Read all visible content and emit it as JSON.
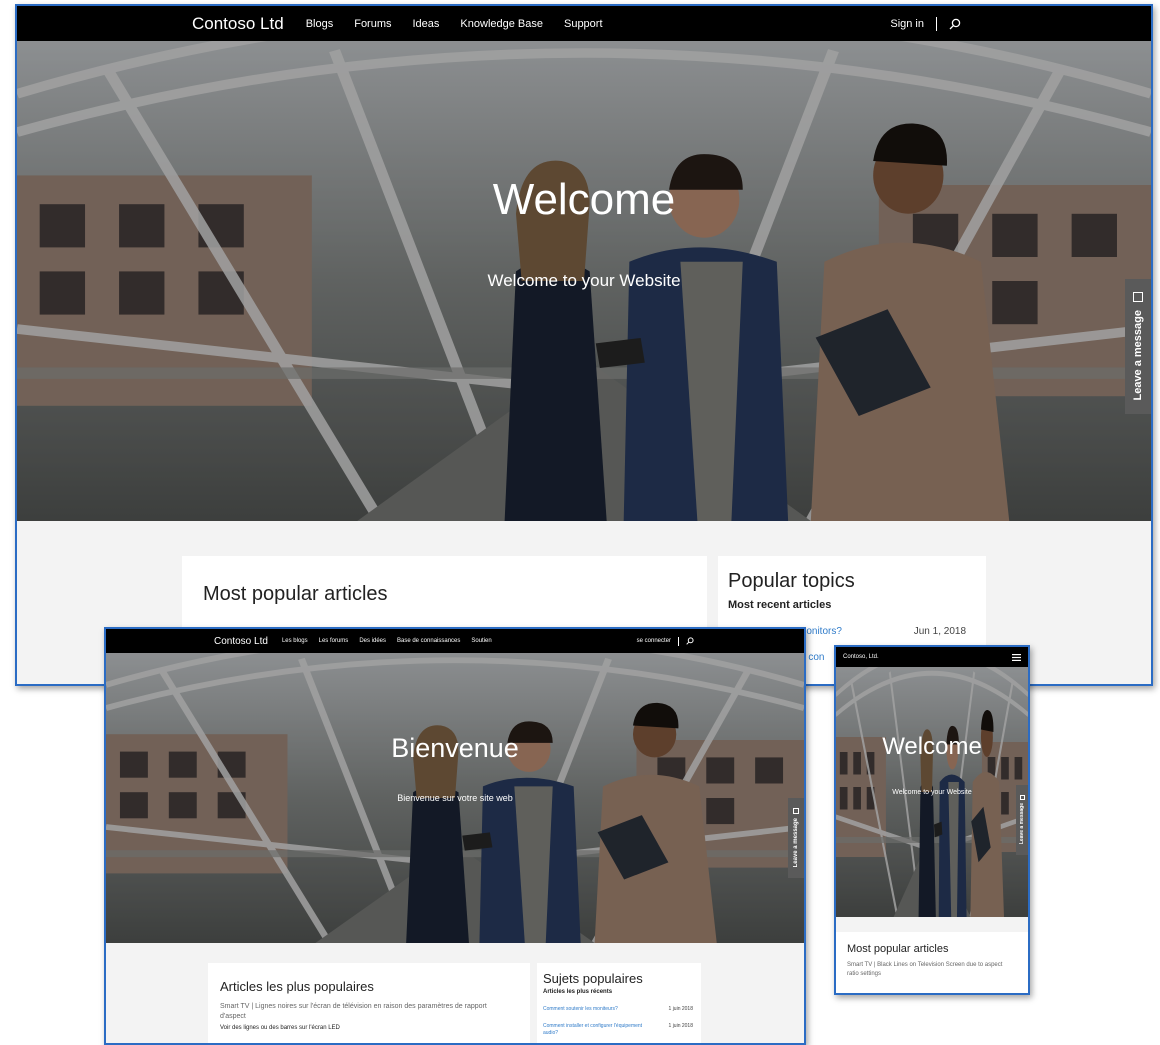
{
  "desktop_en": {
    "brand": "Contoso Ltd",
    "nav": [
      "Blogs",
      "Forums",
      "Ideas",
      "Knowledge Base",
      "Support"
    ],
    "sign_in": "Sign in",
    "hero_title": "Welcome",
    "hero_subtitle": "Welcome to your Website",
    "tab_label": "Leave a message",
    "articles_heading": "Most popular articles",
    "topics_heading": "Popular topics",
    "recent_heading": "Most recent articles",
    "recent_item_1": "Monitors?",
    "recent_item_1_date": "Jun 1, 2018",
    "recent_item_2": "d con"
  },
  "desktop_fr": {
    "brand": "Contoso Ltd",
    "nav": [
      "Les blogs",
      "Les forums",
      "Des idées",
      "Base de connaissances",
      "Soutien"
    ],
    "sign_in": "se connecter",
    "hero_title": "Bienvenue",
    "hero_subtitle": "Bienvenue sur votre site web",
    "tab_label": "Leave a message",
    "articles_heading": "Articles les plus populaires",
    "article_title": "Smart TV | Lignes noires sur l'écran de télévision en raison des paramètres de rapport d'aspect",
    "article_snippet": "Voir des lignes ou des barres sur l'écran LED",
    "topics_heading": "Sujets populaires",
    "recent_heading": "Articles les plus récents",
    "recent_item_1": "Comment soutenir les moniteurs?",
    "recent_item_1_date": "1 juin 2018",
    "recent_item_2": "Comment installer et configurer l'équipement audio?",
    "recent_item_2_date": "1 juin 2018"
  },
  "mobile_en": {
    "brand": "Contoso, Ltd.",
    "hero_title": "Welcome",
    "hero_subtitle": "Welcome to your Website",
    "tab_label": "Leave a message",
    "articles_heading": "Most popular articles",
    "article_title": "Smart TV | Black Lines on Television Screen due to aspect ratio settings"
  },
  "colors": {
    "nav": "#000000",
    "link": "#2f7bc9",
    "frame_border": "#2b6cc4",
    "page_bg": "#f3f3f3",
    "tab": "#5a5a5a"
  },
  "icons": {
    "search": "search-icon",
    "menu": "hamburger-menu-icon",
    "message": "message-icon"
  }
}
